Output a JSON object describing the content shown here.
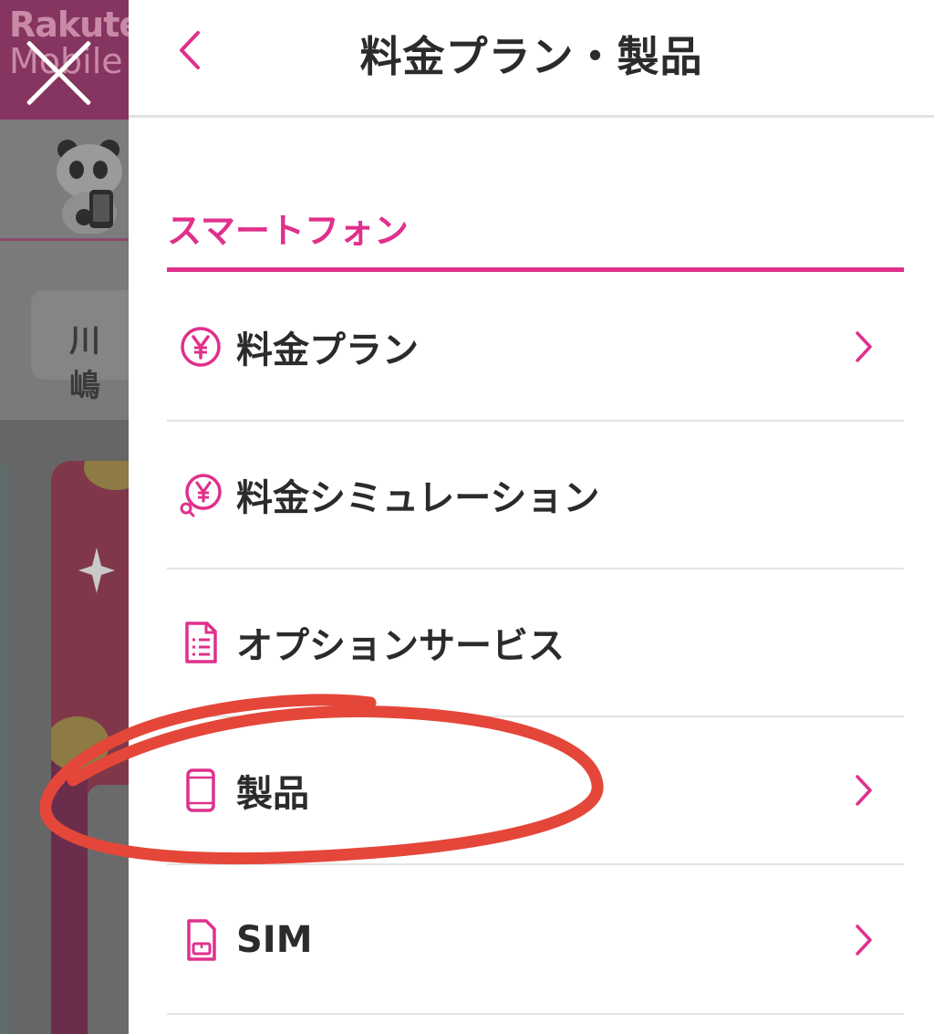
{
  "background": {
    "logo_line1": "Rakuten",
    "logo_line2": "Mobile",
    "search_text": "川嶋"
  },
  "drawer": {
    "title": "料金プラン・製品",
    "section_title": "スマートフォン",
    "items": [
      {
        "label": "料金プラン",
        "icon": "yen-circle-icon",
        "has_chevron": true
      },
      {
        "label": "料金シミュレーション",
        "icon": "yen-search-icon",
        "has_chevron": false
      },
      {
        "label": "オプションサービス",
        "icon": "document-list-icon",
        "has_chevron": false
      },
      {
        "label": "製品",
        "icon": "smartphone-icon",
        "has_chevron": true
      },
      {
        "label": "SIM",
        "icon": "sim-card-icon",
        "has_chevron": true
      }
    ]
  },
  "colors": {
    "accent": "#e0308c",
    "annotation": "#e4473a",
    "header_bg": "#85355f"
  }
}
